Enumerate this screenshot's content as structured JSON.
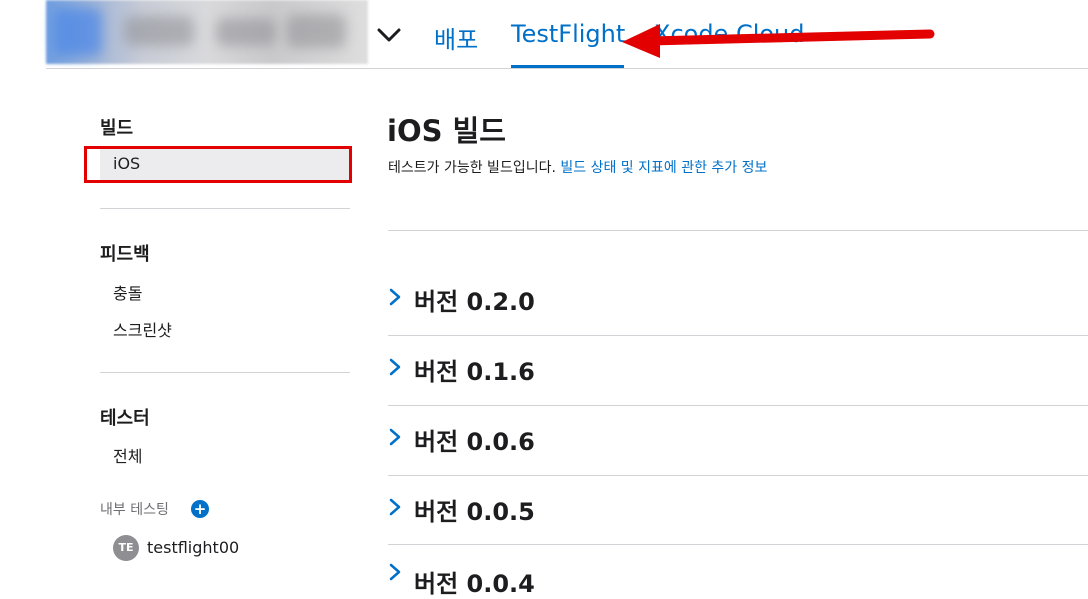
{
  "nav": {
    "tabs": [
      {
        "label": "배포"
      },
      {
        "label": "TestFlight"
      },
      {
        "label": "Xcode Cloud"
      }
    ]
  },
  "sidebar": {
    "builds_heading": "빌드",
    "builds_items": [
      {
        "label": "iOS"
      }
    ],
    "feedback_heading": "피드백",
    "feedback_items": [
      {
        "label": "충돌"
      },
      {
        "label": "스크린샷"
      }
    ],
    "testers_heading": "테스터",
    "testers_items": [
      {
        "label": "전체"
      }
    ],
    "internal_testing_label": "내부 테스팅",
    "internal_testers": [
      {
        "initials": "TE",
        "name": "testflight00"
      }
    ]
  },
  "main": {
    "title": "iOS 빌드",
    "subtitle_text": "테스트가 가능한 빌드입니다.",
    "subtitle_link": "빌드 상태 및 지표에 관한 추가 정보",
    "versions": [
      {
        "label": "버전 0.2.0"
      },
      {
        "label": "버전 0.1.6"
      },
      {
        "label": "버전 0.0.6"
      },
      {
        "label": "버전 0.0.5"
      },
      {
        "label": "버전 0.0.4"
      }
    ]
  },
  "colors": {
    "accent": "#0070c9",
    "annotation": "#e30000"
  }
}
